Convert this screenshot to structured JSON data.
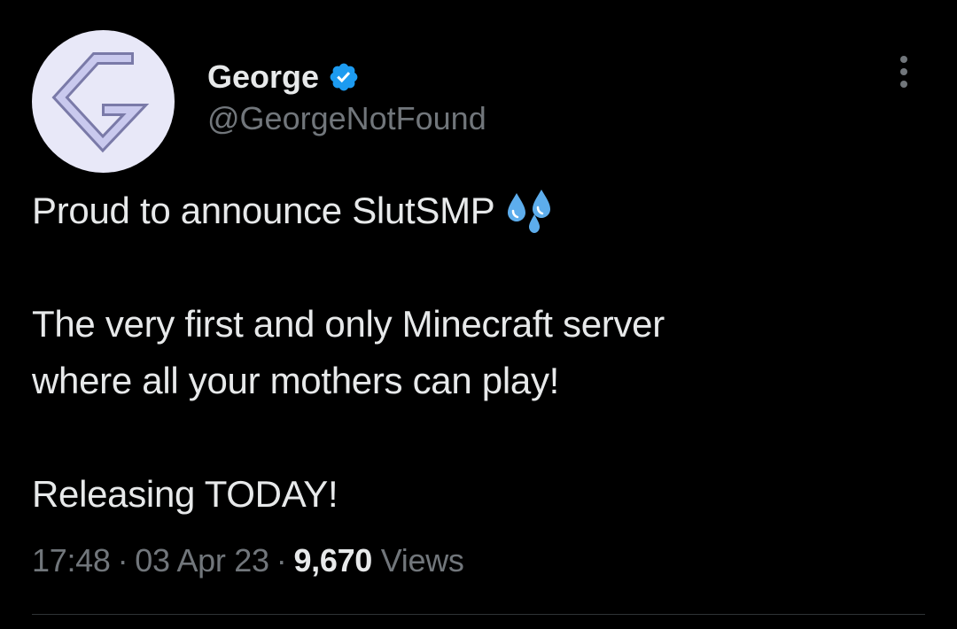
{
  "user": {
    "display_name": "George",
    "handle": "@GeorgeNotFound",
    "verified": true,
    "avatar_icon": "george-logo-icon",
    "verified_color": "#1d9bf0"
  },
  "tweet": {
    "line1": "Proud to announce SlutSMP",
    "line1_emoji": "sweat-droplets-emoji",
    "paragraph2_line1": "The very first and only Minecraft server",
    "paragraph2_line2": "where all your mothers can play!",
    "paragraph3": "Releasing TODAY!"
  },
  "meta": {
    "time": "17:48",
    "separator": "·",
    "date": "03 Apr 23",
    "views_count": "9,670",
    "views_label": "Views"
  },
  "colors": {
    "background": "#000000",
    "text_primary": "#e7e9ea",
    "text_secondary": "#71767b",
    "divider": "#2f3336"
  }
}
